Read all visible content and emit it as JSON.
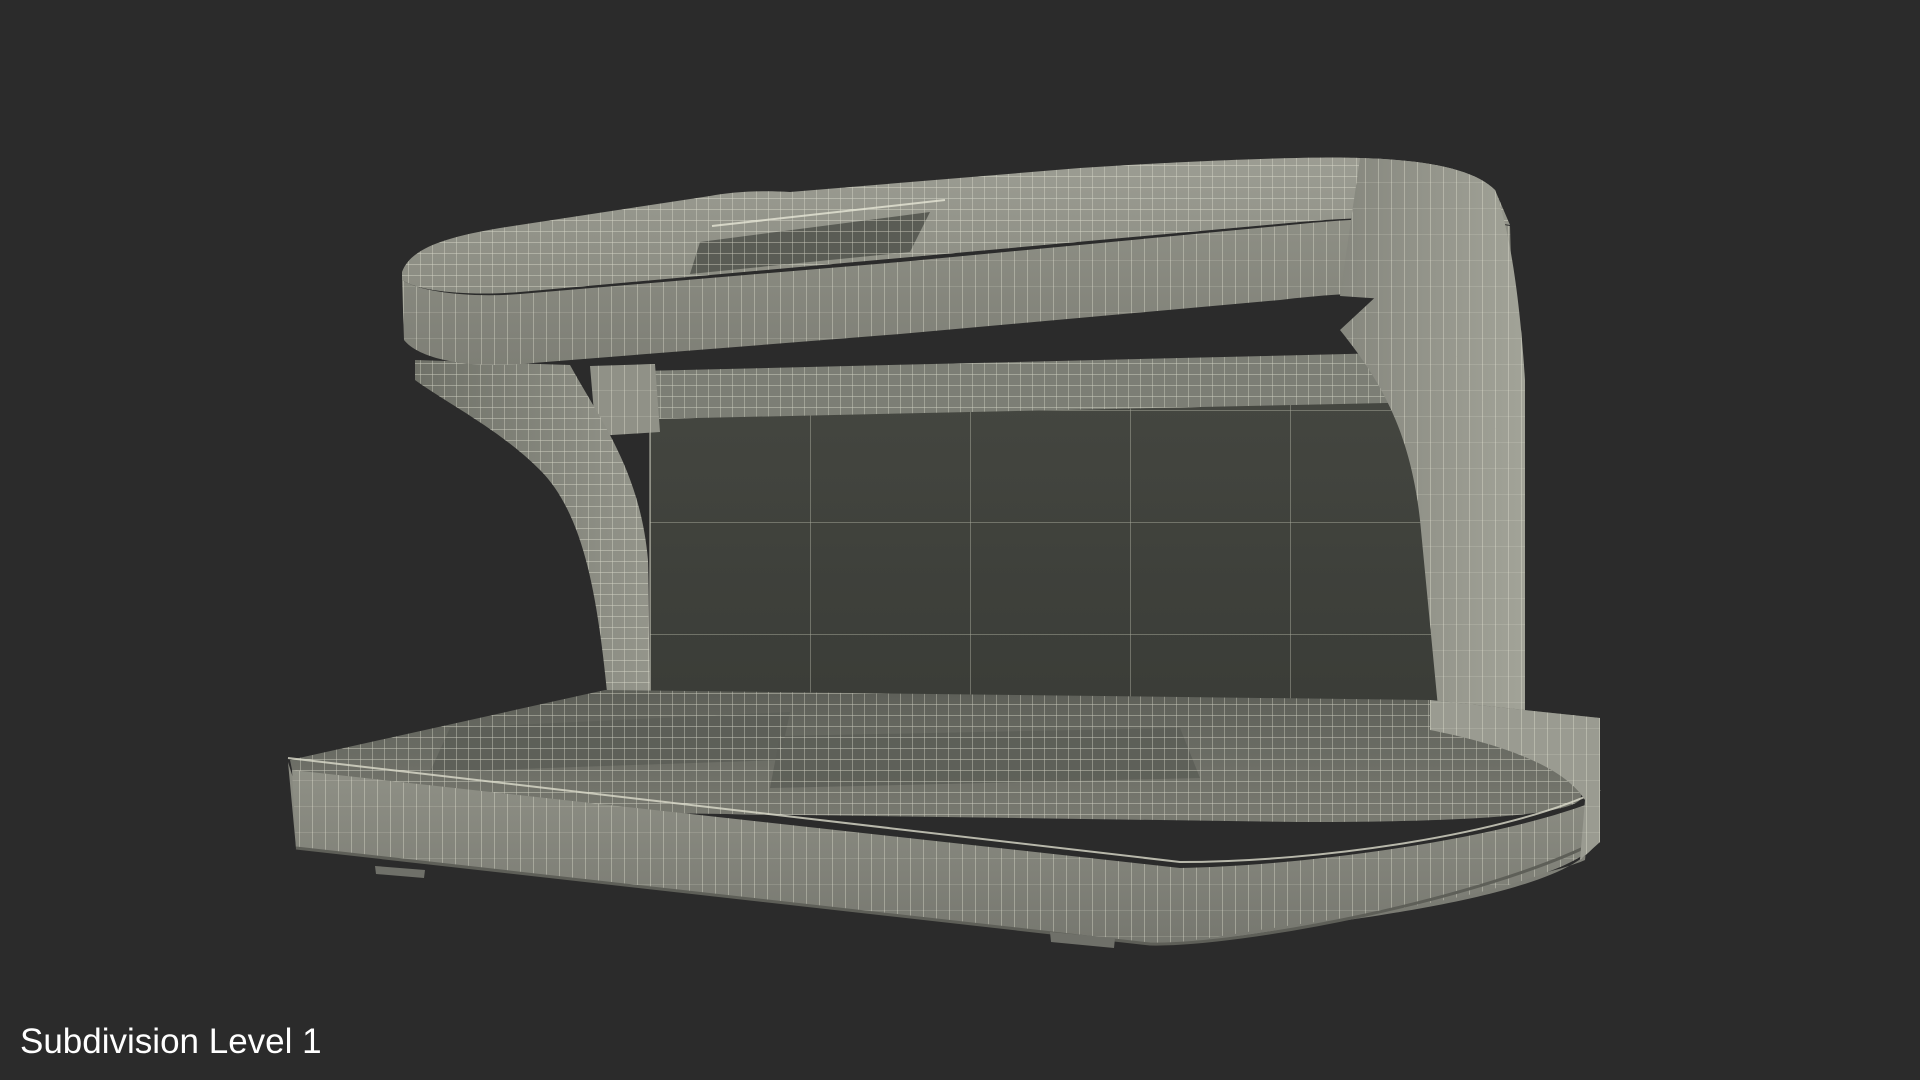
{
  "caption": "Subdivision Level 1",
  "colors": {
    "background": "#2b2b2b",
    "model_surface": "#8b8b80",
    "wire": "#e6e6d6",
    "caption_text": "#ffffff"
  }
}
